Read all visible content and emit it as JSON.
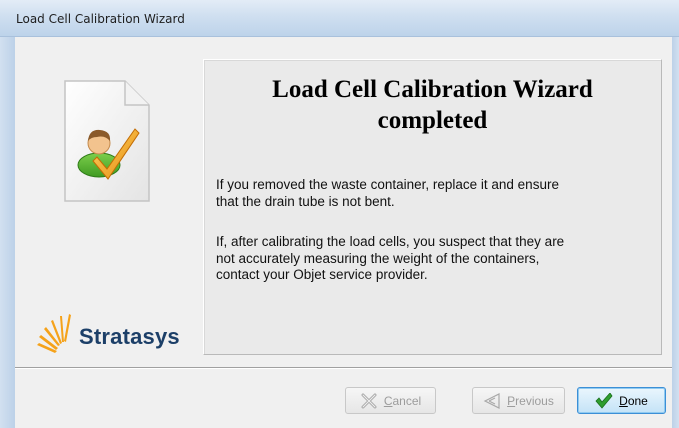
{
  "window": {
    "title": "Load Cell Calibration Wizard"
  },
  "branding": {
    "logo_text": "Stratasys"
  },
  "panel": {
    "heading_line1": "Load Cell Calibration Wizard",
    "heading_line2": "completed",
    "paragraph1_line1": "If you removed the waste container, replace it and ensure",
    "paragraph1_line2": "that the drain tube is not bent.",
    "paragraph2_line1": "If, after calibrating the load cells, you suspect that they are",
    "paragraph2_line2": "not accurately measuring the weight of the containers,",
    "paragraph2_line3": "contact your Objet service provider."
  },
  "buttons": {
    "cancel": {
      "label": "Cancel",
      "enabled": false,
      "icon": "cancel-x-icon"
    },
    "previous": {
      "label": "Previous",
      "enabled": false,
      "icon": "previous-arrow-icon"
    },
    "done": {
      "label": "Done",
      "enabled": true,
      "icon": "green-check-icon"
    }
  },
  "colors": {
    "logo_text": "#1c3f68",
    "logo_rays": "#f5a21a",
    "done_check": "#2f9e2f"
  }
}
